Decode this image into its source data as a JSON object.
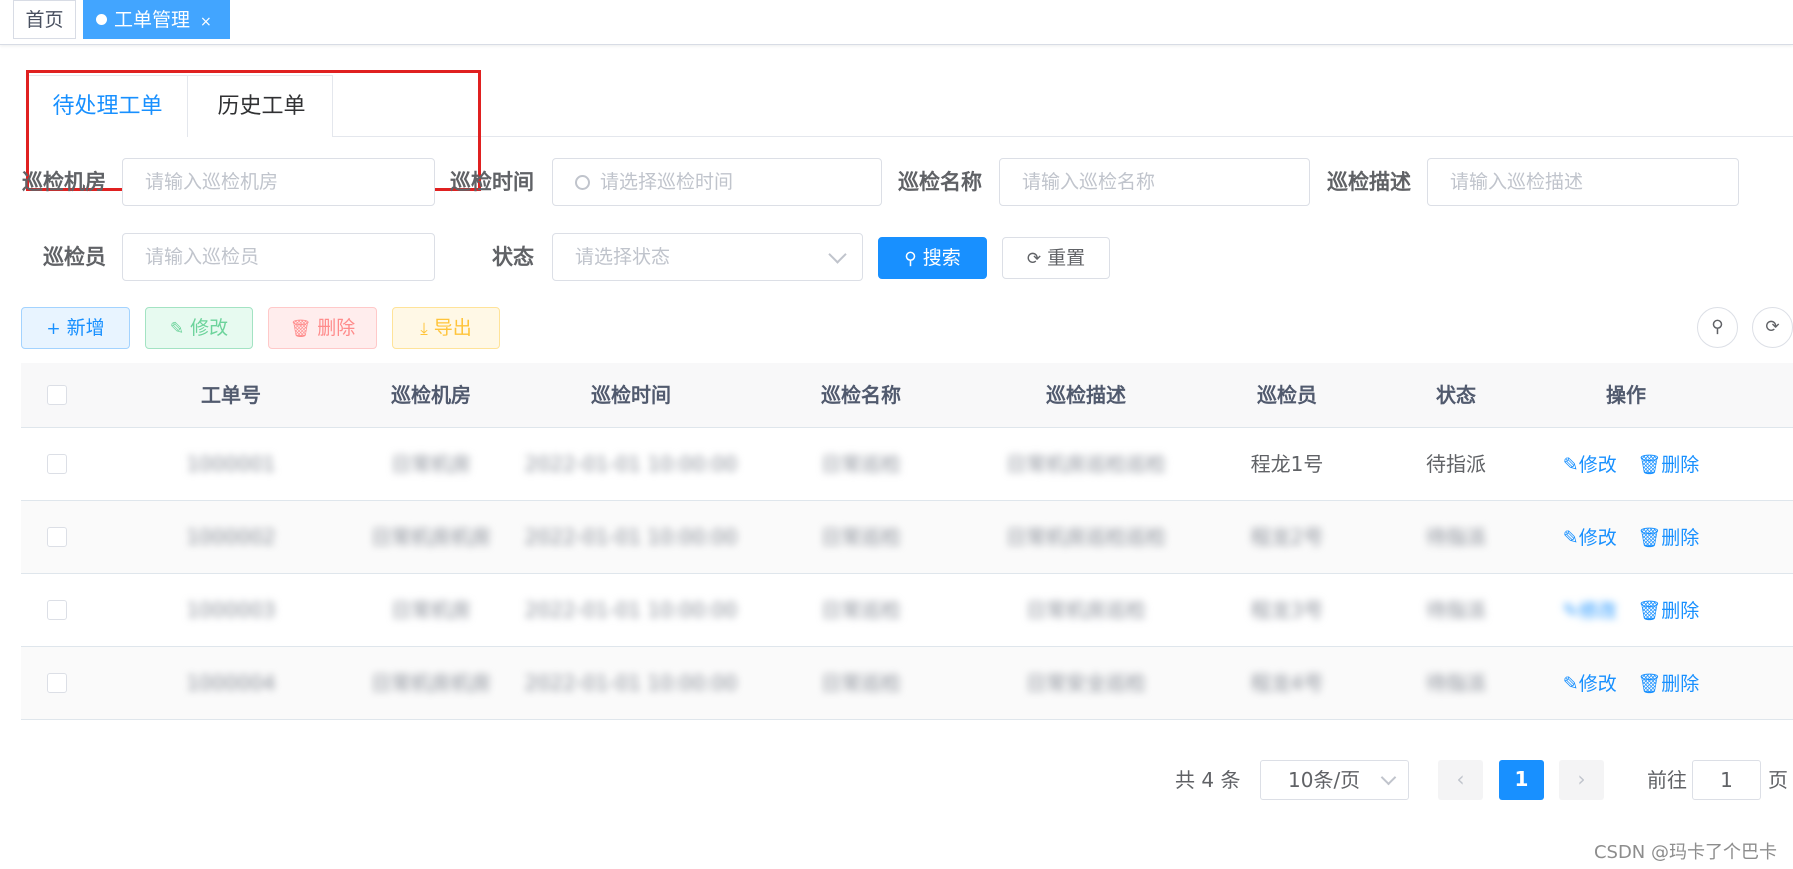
{
  "tags": {
    "home": "首页",
    "active": "工单管理",
    "close": "×"
  },
  "tabs": {
    "pending": "待处理工单",
    "history": "历史工单"
  },
  "form": {
    "room_label": "巡检机房",
    "room_placeholder": "请输入巡检机房",
    "time_label": "巡检时间",
    "time_placeholder": "请选择巡检时间",
    "name_label": "巡检名称",
    "name_placeholder": "请输入巡检名称",
    "desc_label": "巡检描述",
    "desc_placeholder": "请输入巡检描述",
    "inspector_label": "巡检员",
    "inspector_placeholder": "请输入巡检员",
    "status_label": "状态",
    "status_placeholder": "请选择状态",
    "search_btn": "搜索",
    "reset_btn": "重置"
  },
  "toolbar": {
    "add": "新增",
    "edit": "修改",
    "delete": "删除",
    "export": "导出"
  },
  "table": {
    "headers": [
      "工单号",
      "巡检机房",
      "巡检时间",
      "巡检名称",
      "巡检描述",
      "巡检员",
      "状态",
      "操作"
    ],
    "rows": [
      {
        "no": "1000001",
        "room": "日常机房",
        "time": "2022-01-01 10:00:00",
        "name": "日常巡检",
        "desc": "日常机房巡检巡检",
        "inspector": "程龙1号",
        "status": "待指派"
      },
      {
        "no": "1000002",
        "room": "日常机房机房",
        "time": "2022-01-01 10:00:00",
        "name": "日常巡检",
        "desc": "日常机房巡检巡检",
        "inspector": "程龙2号",
        "status": "待指派"
      },
      {
        "no": "1000003",
        "room": "日常机房",
        "time": "2022-01-01 10:00:00",
        "name": "日常巡检",
        "desc": "日常机房巡检",
        "inspector": "程龙3号",
        "status": "待指派"
      },
      {
        "no": "1000004",
        "room": "日常机房机房",
        "time": "2022-01-01 10:00:00",
        "name": "日常巡检",
        "desc": "日常安全巡检",
        "inspector": "程龙4号",
        "status": "待指派"
      }
    ],
    "op_edit": "修改",
    "op_delete": "删除"
  },
  "pagination": {
    "total": "共 4 条",
    "page_size": "10条/页",
    "current": "1",
    "goto_label": "前往",
    "goto_value": "1",
    "page_suffix": "页"
  },
  "watermark": "CSDN @玛卡了个巴卡",
  "colors": {
    "primary": "#1890ff",
    "annotation": "#e02020"
  }
}
